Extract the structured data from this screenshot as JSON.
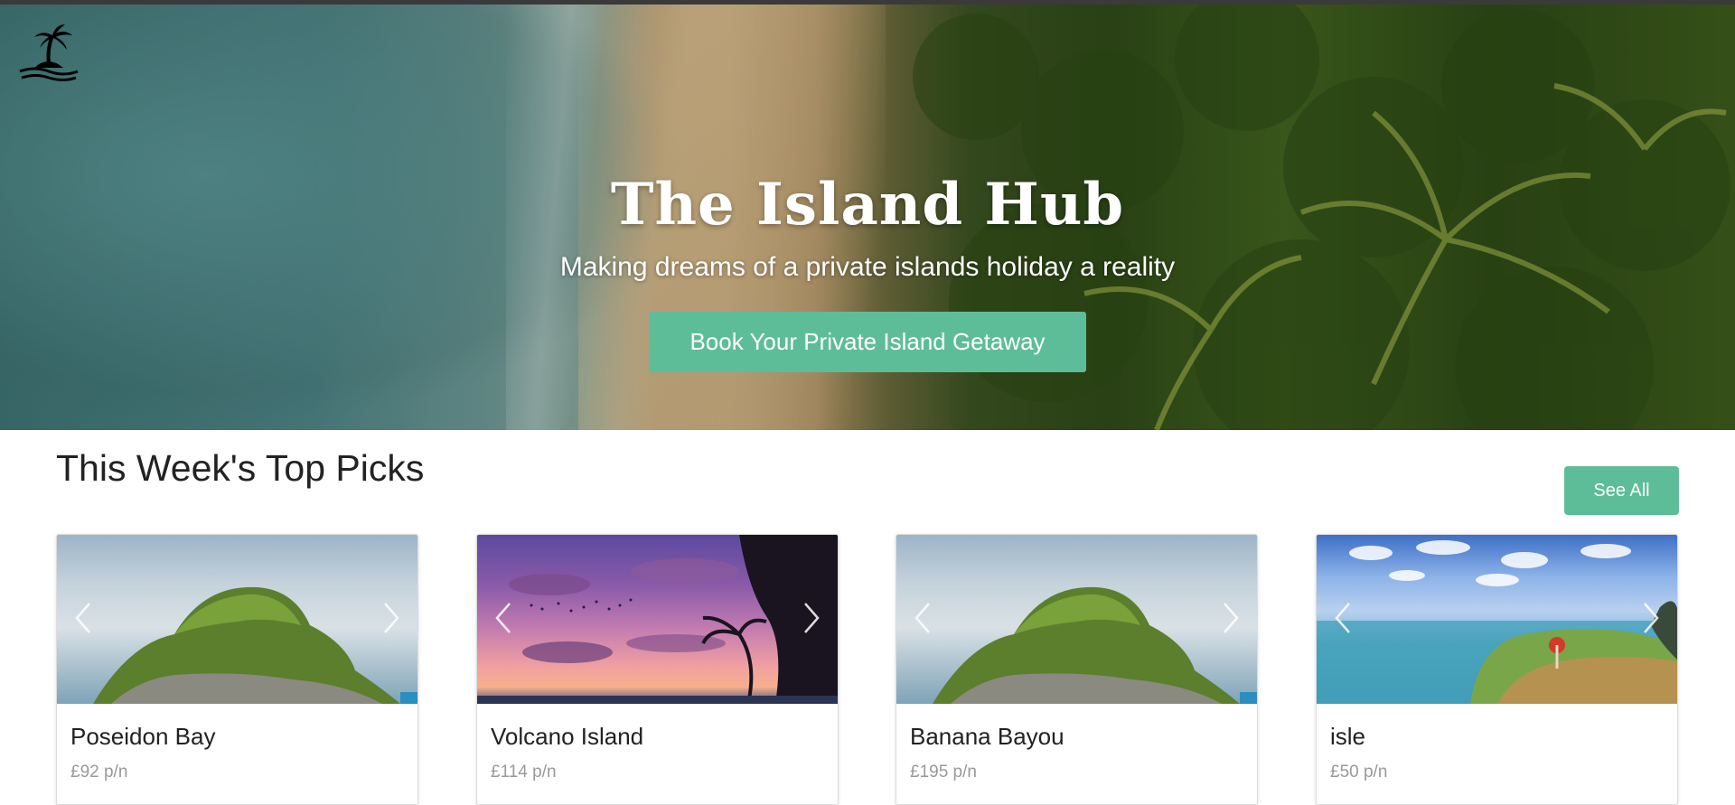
{
  "hero": {
    "title": "The Island Hub",
    "subtitle": "Making dreams of a private islands holiday a reality",
    "cta_label": "Book Your Private Island Getaway"
  },
  "picks": {
    "title": "This Week's Top Picks",
    "see_all_label": "See All",
    "cards": [
      {
        "name": "Poseidon Bay",
        "price": "£92 p/n"
      },
      {
        "name": "Volcano Island",
        "price": "£114 p/n"
      },
      {
        "name": "Banana Bayou",
        "price": "£195 p/n"
      },
      {
        "name": "isle",
        "price": "£50 p/n"
      }
    ]
  },
  "colors": {
    "accent": "#5dbd98",
    "text": "#222222",
    "muted": "#999999"
  },
  "icons": {
    "logo": "palm-island-icon",
    "carousel_prev": "chevron-left-icon",
    "carousel_next": "chevron-right-icon"
  }
}
